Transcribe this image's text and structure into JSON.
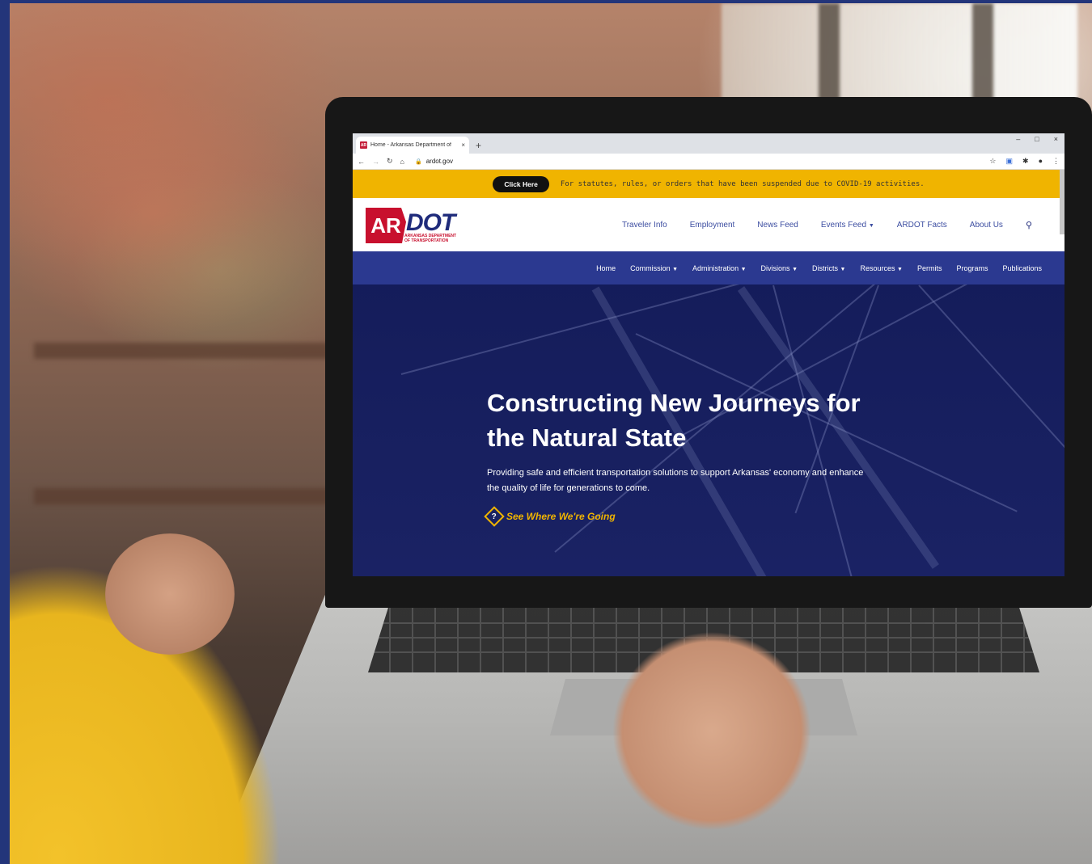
{
  "browser": {
    "tab_title": "Home - Arkansas Department of",
    "tab_close": "×",
    "new_tab": "+",
    "favicon_text": "AR",
    "url": "ardot.gov",
    "window_controls": [
      "–",
      "□",
      "×"
    ]
  },
  "alert": {
    "button_label": "Click Here",
    "text": "For statutes, rules, or orders that have been suspended due to COVID-19 activities.",
    "color": "#f0b400"
  },
  "logo": {
    "ar": "AR",
    "dot": "DOT",
    "sub_line1": "ARKANSAS DEPARTMENT",
    "sub_line2": "OF TRANSPORTATION"
  },
  "top_nav": {
    "items": [
      {
        "label": "Traveler Info",
        "dropdown": false
      },
      {
        "label": "Employment",
        "dropdown": false
      },
      {
        "label": "News Feed",
        "dropdown": false
      },
      {
        "label": "Events Feed",
        "dropdown": true
      },
      {
        "label": "ARDOT Facts",
        "dropdown": false
      },
      {
        "label": "About Us",
        "dropdown": false
      }
    ]
  },
  "main_nav": {
    "color": "#2b3990",
    "items": [
      {
        "label": "Home",
        "dropdown": false
      },
      {
        "label": "Commission",
        "dropdown": true
      },
      {
        "label": "Administration",
        "dropdown": true
      },
      {
        "label": "Divisions",
        "dropdown": true
      },
      {
        "label": "Districts",
        "dropdown": true
      },
      {
        "label": "Resources",
        "dropdown": true
      },
      {
        "label": "Permits",
        "dropdown": false
      },
      {
        "label": "Programs",
        "dropdown": false
      },
      {
        "label": "Publications",
        "dropdown": false
      }
    ]
  },
  "hero": {
    "title_line1": "Constructing New Journeys for",
    "title_line2": "the Natural State",
    "subtitle_line1": "Providing safe and efficient transportation solutions to support Arkansas' economy and enhance",
    "subtitle_line2": "the quality of life for generations to come.",
    "cta_label": "See Where We're Going",
    "cta_icon": "?"
  }
}
